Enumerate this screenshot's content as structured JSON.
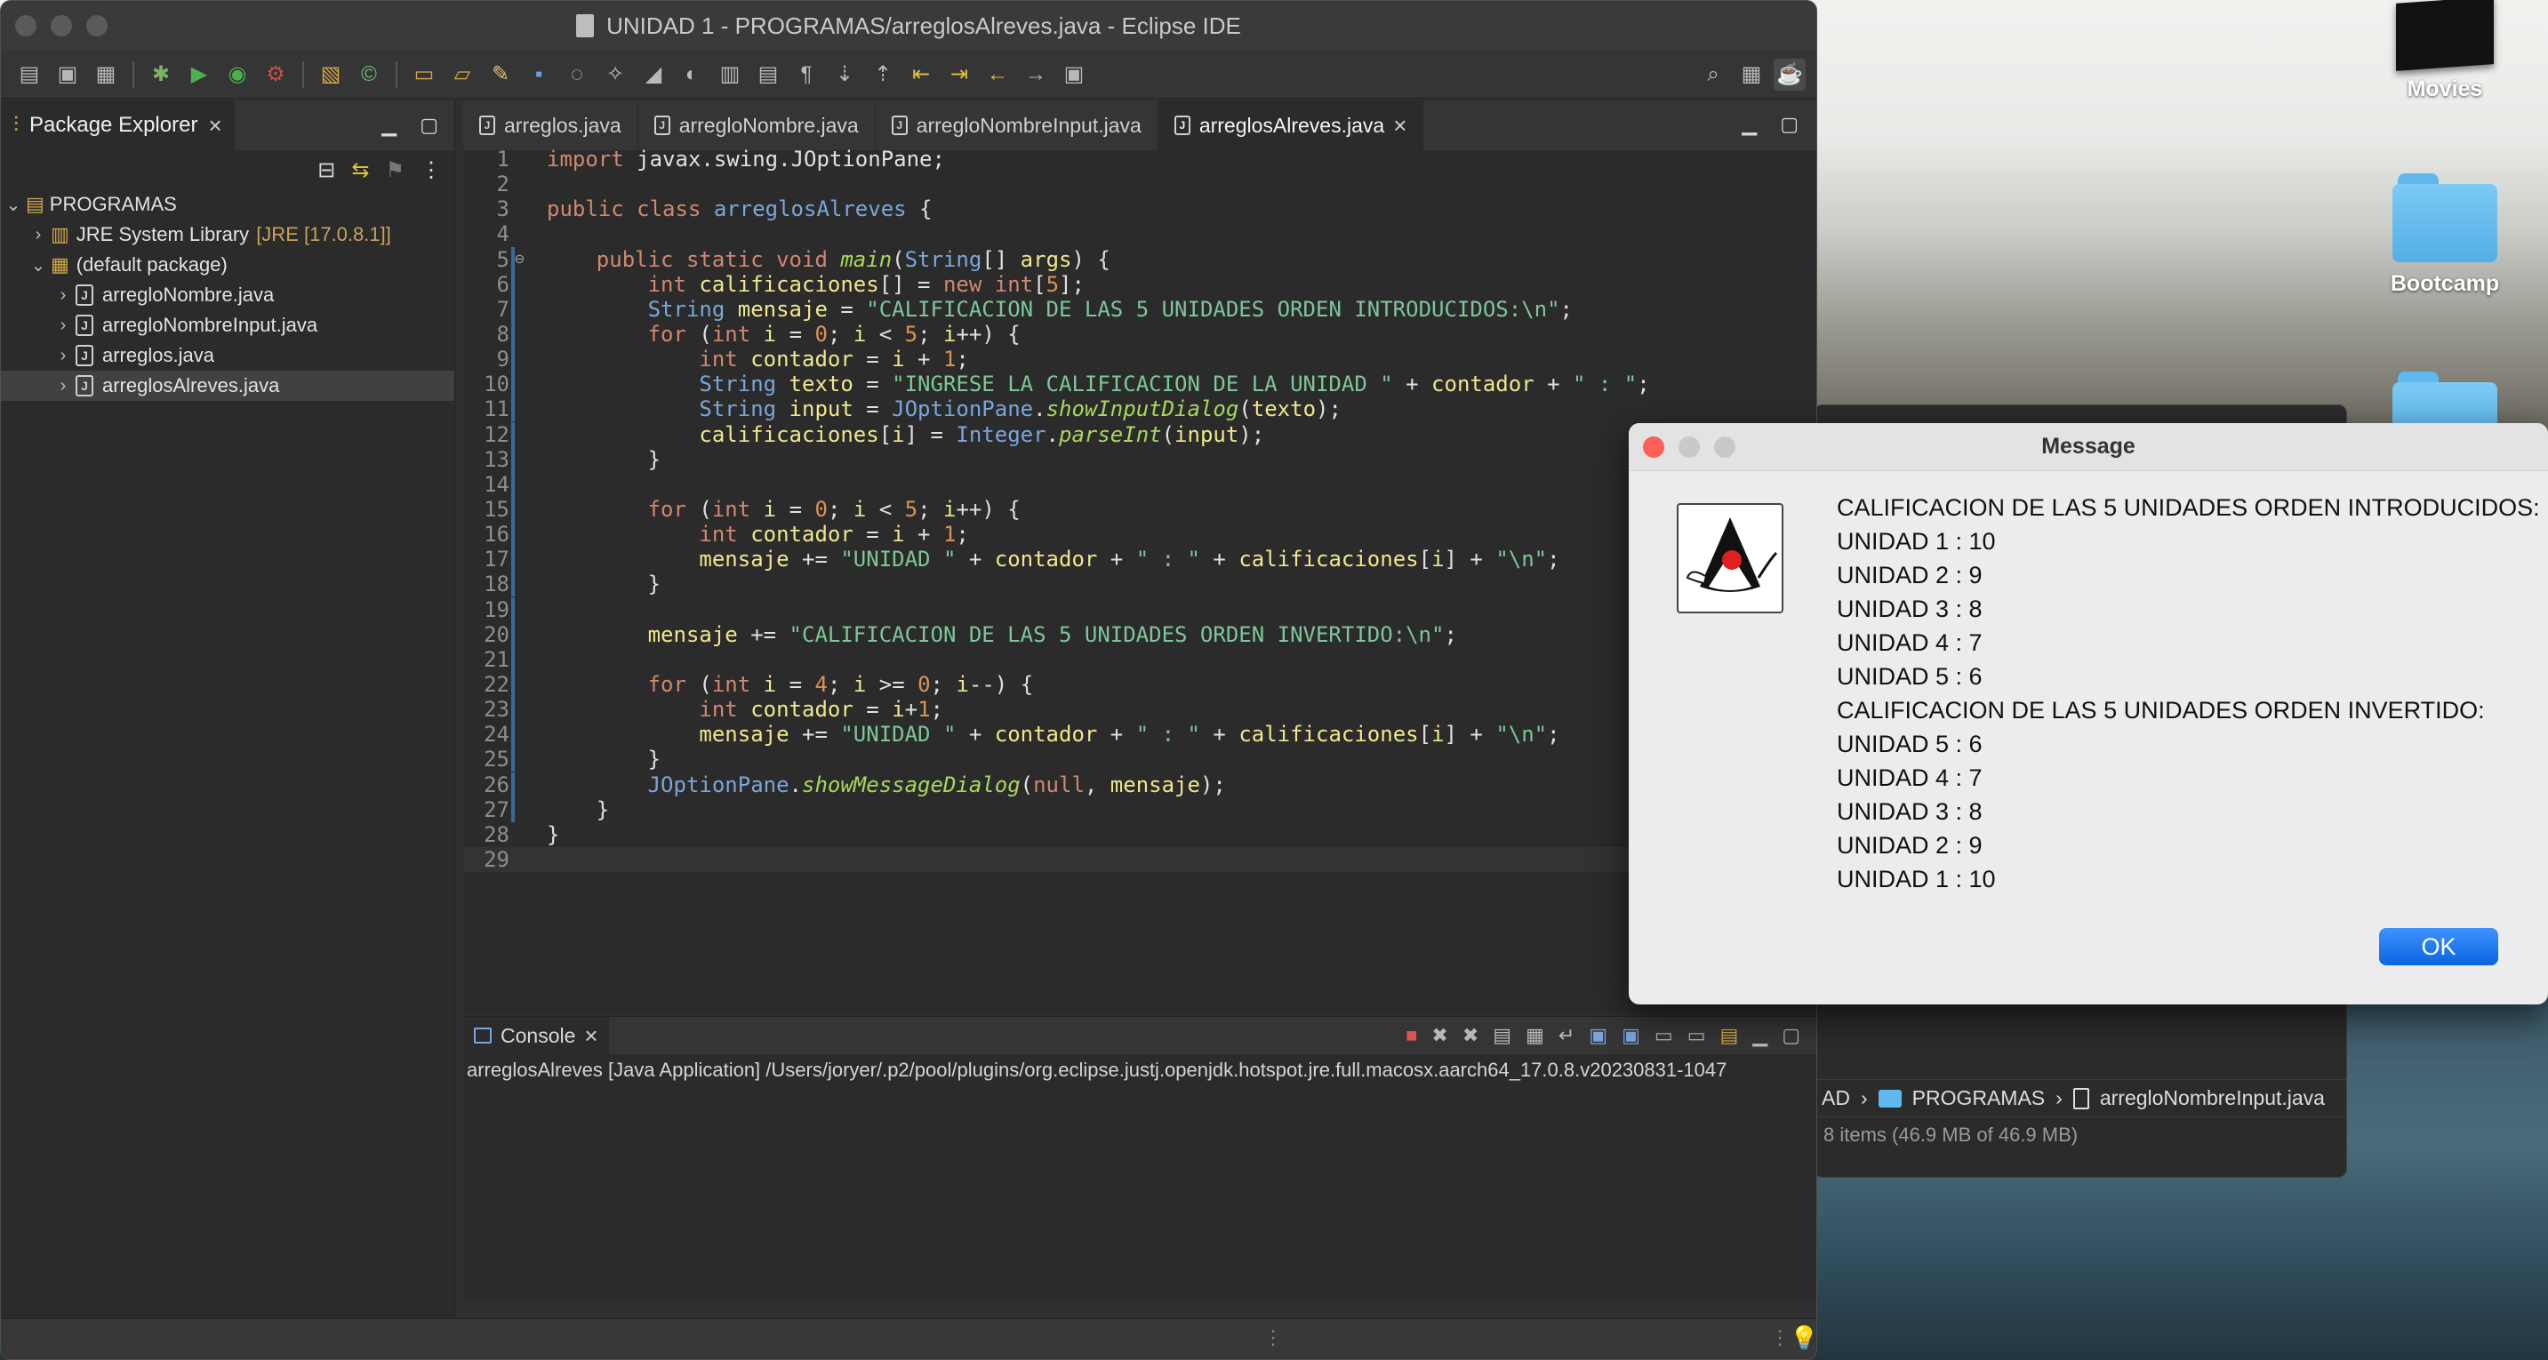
{
  "desktop": {
    "items": [
      {
        "label": "Movies"
      },
      {
        "label": "Bootcamp"
      }
    ]
  },
  "finder": {
    "path": [
      "AD",
      "PROGRAMAS",
      "arregloNombreInput.java"
    ],
    "status": "8 items (46.9 MB of 46.9 MB)"
  },
  "eclipse": {
    "title": "UNIDAD 1 - PROGRAMAS/arreglosAlreves.java - Eclipse IDE",
    "package_explorer": {
      "tab_label": "Package Explorer",
      "project": "PROGRAMAS",
      "jre_label": "JRE System Library",
      "jre_version": "[JRE [17.0.8.1]]",
      "default_package": "(default package)",
      "files": [
        "arregloNombre.java",
        "arregloNombreInput.java",
        "arreglos.java",
        "arreglosAlreves.java"
      ]
    },
    "editor_tabs": [
      "arreglos.java",
      "arregloNombre.java",
      "arregloNombreInput.java",
      "arreglosAlreves.java"
    ],
    "active_editor_tab": "arreglosAlreves.java",
    "code_lines": [
      "import javax.swing.JOptionPane;",
      "",
      "public class arreglosAlreves {",
      "",
      "    public static void main(String[] args) {",
      "        int calificaciones[] = new int[5];",
      "        String mensaje = \"CALIFICACION DE LAS 5 UNIDADES ORDEN INTRODUCIDOS:\\n\";",
      "        for (int i = 0; i < 5; i++) {",
      "            int contador = i + 1;",
      "            String texto = \"INGRESE LA CALIFICACION DE LA UNIDAD \" + contador + \" : \";",
      "            String input = JOptionPane.showInputDialog(texto);",
      "            calificaciones[i] = Integer.parseInt(input);",
      "        }",
      "",
      "        for (int i = 0; i < 5; i++) {",
      "            int contador = i + 1;",
      "            mensaje += \"UNIDAD \" + contador + \" : \" + calificaciones[i] + \"\\n\";",
      "        }",
      "",
      "        mensaje += \"CALIFICACION DE LAS 5 UNIDADES ORDEN INVERTIDO:\\n\";",
      "",
      "        for (int i = 4; i >= 0; i--) {",
      "            int contador = i+1;",
      "            mensaje += \"UNIDAD \" + contador + \" : \" + calificaciones[i] + \"\\n\";",
      "        }",
      "        JOptionPane.showMessageDialog(null, mensaje);",
      "    }",
      "}",
      ""
    ],
    "console": {
      "tab_label": "Console",
      "launch_line": "arreglosAlreves [Java Application] /Users/joryer/.p2/pool/plugins/org.eclipse.justj.openjdk.hotspot.jre.full.macosx.aarch64_17.0.8.v20230831-1047"
    }
  },
  "dialog": {
    "title": "Message",
    "lines": [
      "CALIFICACION DE LAS 5 UNIDADES ORDEN INTRODUCIDOS:",
      "UNIDAD 1 : 10",
      "UNIDAD 2 : 9",
      "UNIDAD 3 : 8",
      "UNIDAD 4 : 7",
      "UNIDAD 5 : 6",
      "CALIFICACION DE LAS 5 UNIDADES ORDEN INVERTIDO:",
      "UNIDAD 5 : 6",
      "UNIDAD 4 : 7",
      "UNIDAD 3 : 8",
      "UNIDAD 2 : 9",
      "UNIDAD 1 : 10"
    ],
    "ok_label": "OK"
  }
}
